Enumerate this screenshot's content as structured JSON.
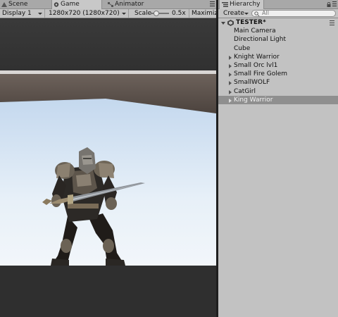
{
  "left_tabs": [
    {
      "label": "Scene",
      "icon": "scene-icon"
    },
    {
      "label": "Game",
      "icon": "game-icon"
    },
    {
      "label": "Animator",
      "icon": "animator-icon"
    }
  ],
  "game_toolbar": {
    "display": "Display 1",
    "resolution": "1280x720 (1280x720)",
    "scale_label": "Scale",
    "scale_value": "0.5x",
    "maximize": "Maximize"
  },
  "hierarchy": {
    "tab_label": "Hierarchy",
    "create_label": "Create",
    "search_placeholder": "All",
    "scene_name": "TESTER*",
    "items": [
      {
        "label": "Main Camera",
        "expandable": false,
        "selected": false
      },
      {
        "label": "Directional Light",
        "expandable": false,
        "selected": false
      },
      {
        "label": "Cube",
        "expandable": false,
        "selected": false
      },
      {
        "label": "Knight Warrior",
        "expandable": true,
        "selected": false
      },
      {
        "label": "Small Orc lvl1",
        "expandable": true,
        "selected": false
      },
      {
        "label": "Small Fire Golem",
        "expandable": true,
        "selected": false
      },
      {
        "label": "SmallWOLF",
        "expandable": true,
        "selected": false
      },
      {
        "label": "CatGirl",
        "expandable": true,
        "selected": false
      },
      {
        "label": "King Warrior",
        "expandable": true,
        "selected": true
      }
    ]
  },
  "colors": {
    "panel_bg": "#c2c2c2",
    "selection": "#8f8f8f",
    "floor": "#dfeaf4",
    "wall": "#5c5048"
  }
}
